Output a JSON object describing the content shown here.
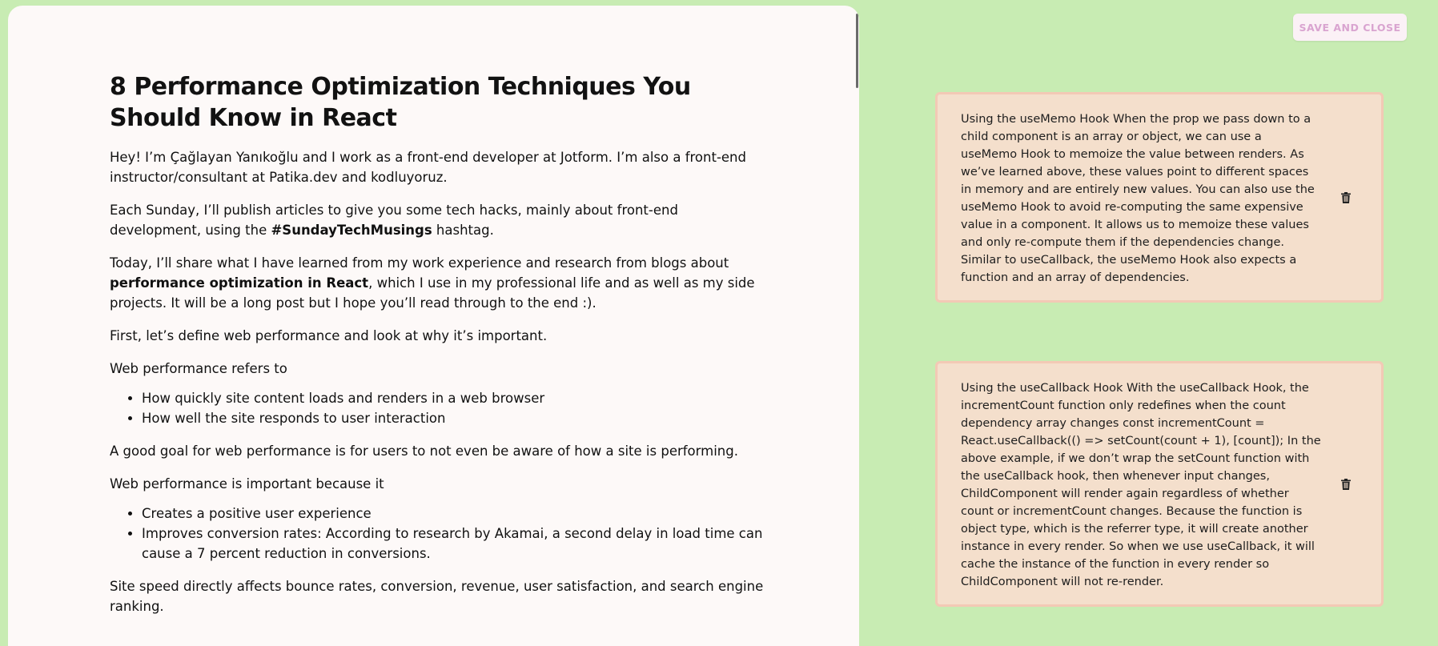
{
  "article": {
    "title": "8 Performance Optimization Techniques You Should Know in React",
    "p1": "Hey! I’m Çağlayan Yanıkoğlu and I work as a front-end developer at Jotform. I’m also a front-end instructor/consultant at Patika.dev and kodluyoruz.",
    "p2_before": "Each Sunday, I’ll publish articles to give you some tech hacks, mainly about front-end development, using the ",
    "p2_bold": "#SundayTechMusings",
    "p2_after": " hashtag.",
    "p3_before": "Today, I’ll share what I have learned from my work experience and research from blogs about ",
    "p3_bold": "performance optimization in React",
    "p3_after": ", which I use in my professional life and as well as my side projects. It will be a long post but I hope you’ll read through to the end :).",
    "p4": "First, let’s define web performance and look at why it’s important.",
    "p5": "Web performance refers to",
    "list1": [
      "How quickly site content loads and renders in a web browser",
      "How well the site responds to user interaction"
    ],
    "p6": "A good goal for web performance is for users to not even be aware of how a site is performing.",
    "p7": "Web performance is important because it",
    "list2": [
      "Creates a positive user experience",
      "Improves conversion rates: According to research by Akamai, a second delay in load time can cause a 7 percent reduction in conversions."
    ],
    "p8": "Site speed directly affects bounce rates, conversion, revenue, user satisfaction, and search engine ranking."
  },
  "toolbar": {
    "save_label": "SAVE AND CLOSE"
  },
  "notes": [
    {
      "text": "Using the useMemo Hook When the prop we pass down to a child component is an array or object, we can use a useMemo Hook to memoize the value between renders. As we’ve learned above, these values point to different spaces in memory and are entirely new values. You can also use the useMemo Hook to avoid re-computing the same expensive value in a component. It allows us to memoize these values and only re-compute them if the dependencies change. Similar to useCallback, the useMemo Hook also expects a function and an array of dependencies.",
      "icon": "trash-icon"
    },
    {
      "text": "Using the useCallback Hook With the useCallback Hook, the incrementCount function only redefines when the count dependency array changes const incrementCount = React.useCallback(() => setCount(count + 1), [count]); In the above example, if we don’t wrap the setCount function with the useCallback hook, then whenever input changes, ChildComponent will render again regardless of whether count or incrementCount changes. Because the function is object type, which is the referrer type, it will create another instance in every render. So when we use useCallback, it will cache the instance of the function in every render so ChildComponent will not re-render.",
      "icon": "trash-icon"
    }
  ],
  "colors": {
    "background": "#c8ecb3",
    "panel": "#fdf9f8",
    "note_bg": "#f4dfcc",
    "note_border": "#f3c9b5",
    "button_text": "#d9a4d0"
  }
}
